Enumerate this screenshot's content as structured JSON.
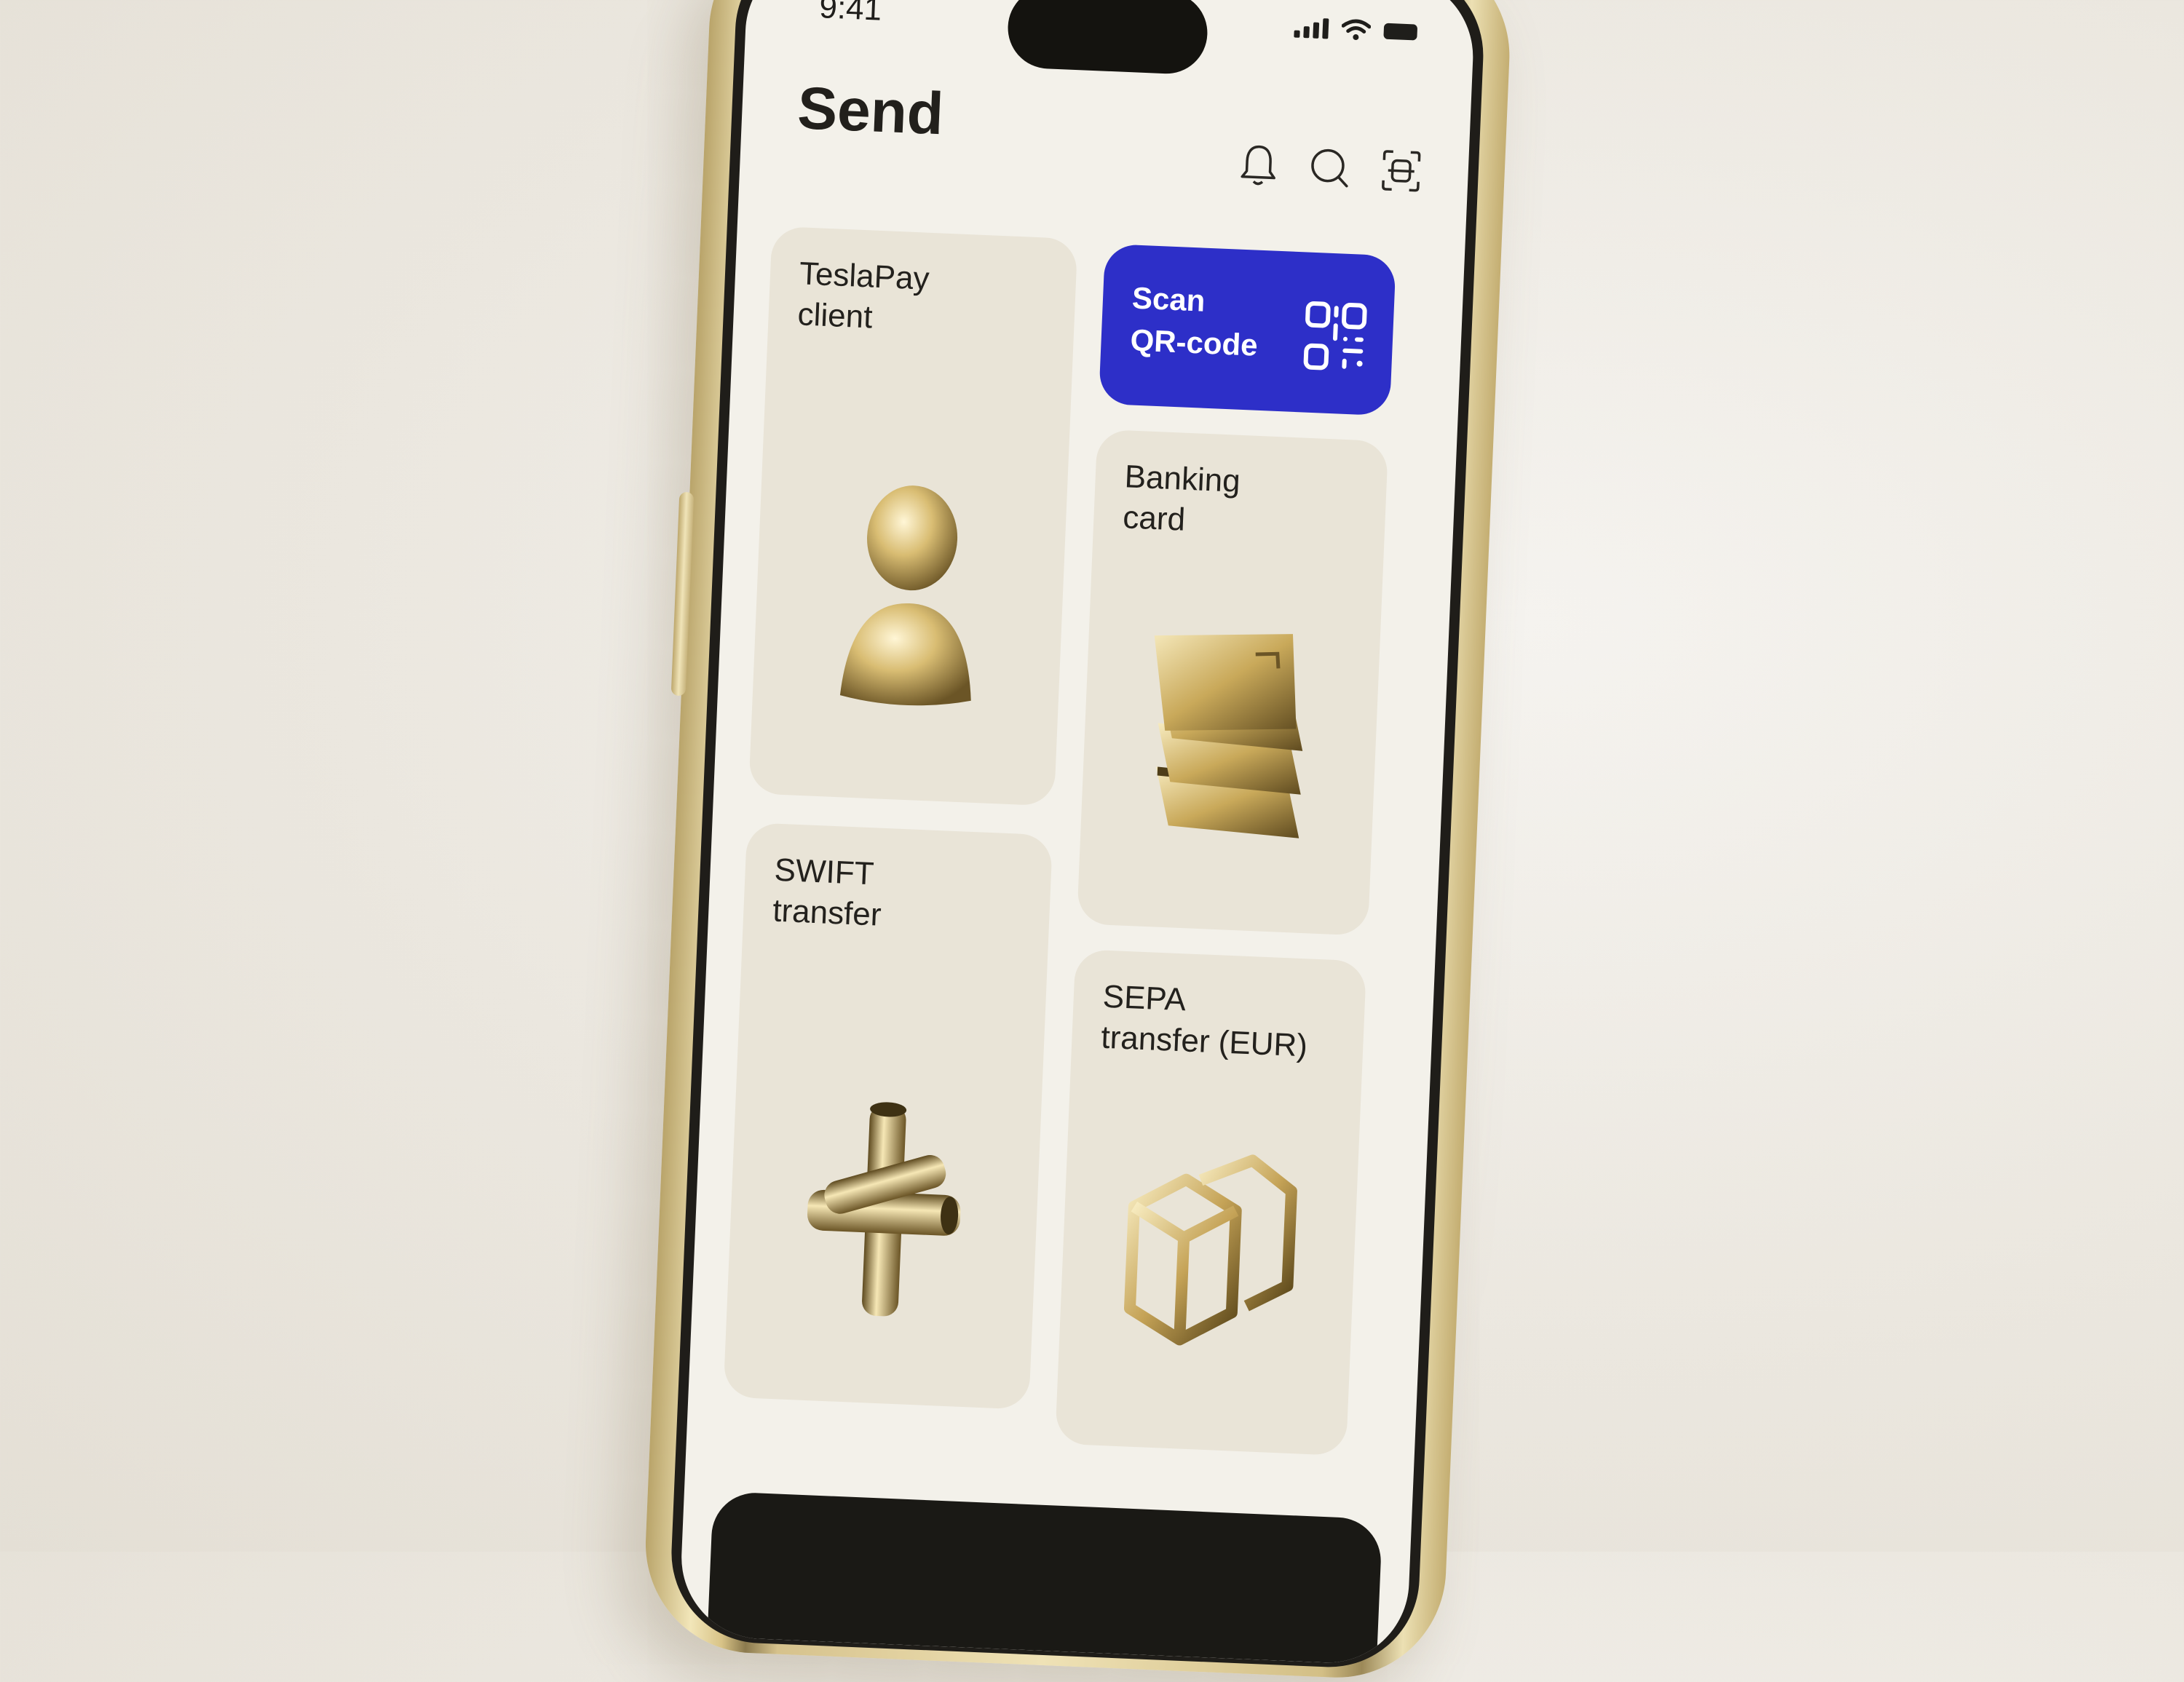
{
  "status_bar": {
    "time": "9:41"
  },
  "header": {
    "title": "Send"
  },
  "header_icons": [
    "bell-icon",
    "search-icon",
    "scan-frame-icon"
  ],
  "cards": {
    "client": {
      "label": "TeslaPay\nclient",
      "icon": "person-icon"
    },
    "scan": {
      "label": "Scan\nQR-code",
      "icon": "qr-code-icon",
      "color": "#2d2fc8"
    },
    "bank": {
      "label": "Banking\ncard",
      "icon": "card-stack-icon"
    },
    "swift": {
      "label": "SWIFT\ntransfer",
      "icon": "cross-pipes-icon"
    },
    "sepa": {
      "label": "SEPA\ntransfer (EUR)",
      "icon": "linked-cubes-icon"
    }
  },
  "colors": {
    "accent": "#2d2fc8",
    "gold": "#c9ad62",
    "background": "#f3f1ea"
  }
}
